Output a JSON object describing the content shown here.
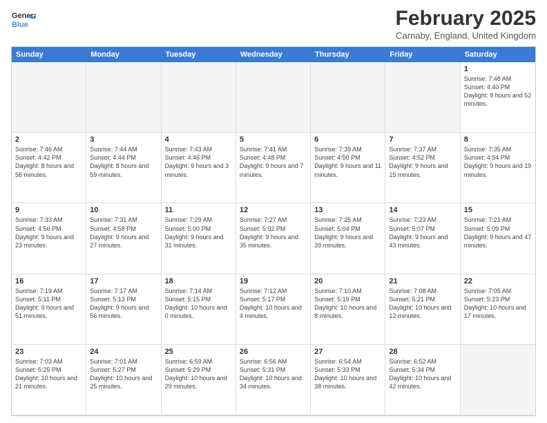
{
  "logo": {
    "line1": "General",
    "line2": "Blue"
  },
  "header": {
    "month_year": "February 2025",
    "location": "Carnaby, England, United Kingdom"
  },
  "day_headers": [
    "Sunday",
    "Monday",
    "Tuesday",
    "Wednesday",
    "Thursday",
    "Friday",
    "Saturday"
  ],
  "weeks": [
    [
      {
        "day": "",
        "info": ""
      },
      {
        "day": "",
        "info": ""
      },
      {
        "day": "",
        "info": ""
      },
      {
        "day": "",
        "info": ""
      },
      {
        "day": "",
        "info": ""
      },
      {
        "day": "",
        "info": ""
      },
      {
        "day": "1",
        "info": "Sunrise: 7:48 AM\nSunset: 4:40 PM\nDaylight: 8 hours and 52 minutes."
      }
    ],
    [
      {
        "day": "2",
        "info": "Sunrise: 7:46 AM\nSunset: 4:42 PM\nDaylight: 8 hours and 56 minutes."
      },
      {
        "day": "3",
        "info": "Sunrise: 7:44 AM\nSunset: 4:44 PM\nDaylight: 8 hours and 59 minutes."
      },
      {
        "day": "4",
        "info": "Sunrise: 7:43 AM\nSunset: 4:46 PM\nDaylight: 9 hours and 3 minutes."
      },
      {
        "day": "5",
        "info": "Sunrise: 7:41 AM\nSunset: 4:48 PM\nDaylight: 9 hours and 7 minutes."
      },
      {
        "day": "6",
        "info": "Sunrise: 7:39 AM\nSunset: 4:50 PM\nDaylight: 9 hours and 11 minutes."
      },
      {
        "day": "7",
        "info": "Sunrise: 7:37 AM\nSunset: 4:52 PM\nDaylight: 9 hours and 15 minutes."
      },
      {
        "day": "8",
        "info": "Sunrise: 7:35 AM\nSunset: 4:54 PM\nDaylight: 9 hours and 19 minutes."
      }
    ],
    [
      {
        "day": "9",
        "info": "Sunrise: 7:33 AM\nSunset: 4:56 PM\nDaylight: 9 hours and 23 minutes."
      },
      {
        "day": "10",
        "info": "Sunrise: 7:31 AM\nSunset: 4:58 PM\nDaylight: 9 hours and 27 minutes."
      },
      {
        "day": "11",
        "info": "Sunrise: 7:29 AM\nSunset: 5:00 PM\nDaylight: 9 hours and 31 minutes."
      },
      {
        "day": "12",
        "info": "Sunrise: 7:27 AM\nSunset: 5:02 PM\nDaylight: 9 hours and 35 minutes."
      },
      {
        "day": "13",
        "info": "Sunrise: 7:25 AM\nSunset: 5:04 PM\nDaylight: 9 hours and 39 minutes."
      },
      {
        "day": "14",
        "info": "Sunrise: 7:23 AM\nSunset: 5:07 PM\nDaylight: 9 hours and 43 minutes."
      },
      {
        "day": "15",
        "info": "Sunrise: 7:21 AM\nSunset: 5:09 PM\nDaylight: 9 hours and 47 minutes."
      }
    ],
    [
      {
        "day": "16",
        "info": "Sunrise: 7:19 AM\nSunset: 5:11 PM\nDaylight: 9 hours and 51 minutes."
      },
      {
        "day": "17",
        "info": "Sunrise: 7:17 AM\nSunset: 5:13 PM\nDaylight: 9 hours and 56 minutes."
      },
      {
        "day": "18",
        "info": "Sunrise: 7:14 AM\nSunset: 5:15 PM\nDaylight: 10 hours and 0 minutes."
      },
      {
        "day": "19",
        "info": "Sunrise: 7:12 AM\nSunset: 5:17 PM\nDaylight: 10 hours and 4 minutes."
      },
      {
        "day": "20",
        "info": "Sunrise: 7:10 AM\nSunset: 5:19 PM\nDaylight: 10 hours and 8 minutes."
      },
      {
        "day": "21",
        "info": "Sunrise: 7:08 AM\nSunset: 5:21 PM\nDaylight: 10 hours and 12 minutes."
      },
      {
        "day": "22",
        "info": "Sunrise: 7:05 AM\nSunset: 5:23 PM\nDaylight: 10 hours and 17 minutes."
      }
    ],
    [
      {
        "day": "23",
        "info": "Sunrise: 7:03 AM\nSunset: 5:25 PM\nDaylight: 10 hours and 21 minutes."
      },
      {
        "day": "24",
        "info": "Sunrise: 7:01 AM\nSunset: 5:27 PM\nDaylight: 10 hours and 25 minutes."
      },
      {
        "day": "25",
        "info": "Sunrise: 6:59 AM\nSunset: 5:29 PM\nDaylight: 10 hours and 29 minutes."
      },
      {
        "day": "26",
        "info": "Sunrise: 6:56 AM\nSunset: 5:31 PM\nDaylight: 10 hours and 34 minutes."
      },
      {
        "day": "27",
        "info": "Sunrise: 6:54 AM\nSunset: 5:33 PM\nDaylight: 10 hours and 38 minutes."
      },
      {
        "day": "28",
        "info": "Sunrise: 6:52 AM\nSunset: 5:34 PM\nDaylight: 10 hours and 42 minutes."
      },
      {
        "day": "",
        "info": ""
      }
    ]
  ]
}
